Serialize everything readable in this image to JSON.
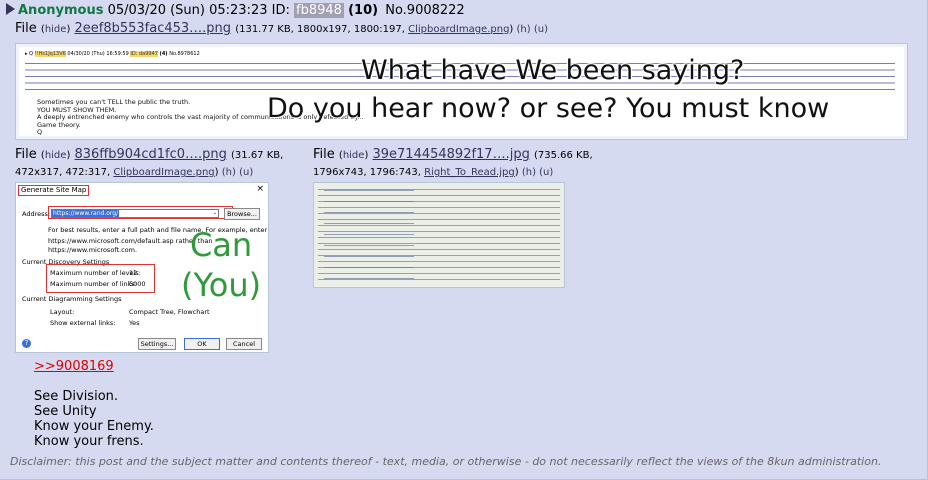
{
  "post": {
    "name": "Anonymous",
    "datetime": "05/03/20 (Sun) 05:23:23",
    "id_label": "ID:",
    "poster_id": "fb8948",
    "post_count": "(10)",
    "number": "No.9008222"
  },
  "files": [
    {
      "label": "File",
      "hide": "hide",
      "filename": "2eef8b553fac453….png",
      "meta": "(131.77 KB, 1800x197, 1800:197,",
      "original_name": "ClipboardImage.png",
      "h": "(h)",
      "u": "(u)",
      "close": ")"
    },
    {
      "label": "File",
      "hide": "hide",
      "filename": "836ffb904cd1fc0….png",
      "meta_a": "(31.67 KB,",
      "meta_b": "472x317, 472:317,",
      "original_name": "ClipboardImage.png",
      "h": "(h)",
      "u": "(u)",
      "close": ")"
    },
    {
      "label": "File",
      "hide": "hide",
      "filename": "39e714454892f17….jpg",
      "meta_a": "(735.66 KB,",
      "meta_b": "1796x743, 1796:743,",
      "original_name": "Right_To_Read.jpg",
      "h": "(h)",
      "u": "(u)",
      "close": ")"
    }
  ],
  "thumb1": {
    "header_q": "Q",
    "header_trip": "!!Hs1Jq13V6",
    "header_date": "04/30/20 (Thu) 16:59:59",
    "header_id": "ID: da9947",
    "header_count": "(4)",
    "header_no": "No.8978612",
    "post_text": "Sometimes you can't TELL the public the truth.\nYOU MUST SHOW THEM.\nA deeply entrenched enemy who controls the vast majority of communications is only defeated by...\nGame theory.\nQ",
    "overlay_line1": "What have We been saying?",
    "overlay_line2": "Do you hear now? or see? You must know"
  },
  "thumb2": {
    "title": "Generate Site Map",
    "close": "×",
    "address_label": "Address:",
    "address_value": "https://www.rand.org/",
    "browse": "Browse...",
    "hint1": "For best results, enter a full path and file name. For example, enter",
    "hint2": "https://www.microsoft.com/default.asp rather than",
    "hint3": "https://www.microsoft.com.",
    "section1": "Current Discovery Settings",
    "max_levels_label": "Maximum number of levels:",
    "max_levels_value": "12",
    "max_links_label": "Maximum number of links:",
    "max_links_value": "5000",
    "section2": "Current Diagramming Settings",
    "layout_label": "Layout:",
    "layout_value": "Compact Tree, Flowchart",
    "external_label": "Show external links:",
    "external_value": "Yes",
    "settings_btn": "Settings...",
    "ok_btn": "OK",
    "cancel_btn": "Cancel",
    "help": "?",
    "overlay": "Can\n(You)"
  },
  "quote_link": ">>9008169",
  "body_lines": [
    "See Division.",
    "See Unity",
    "Know your Enemy.",
    "Know your frens."
  ],
  "disclaimer": "Disclaimer: this post and the subject matter and contents thereof - text, media, or otherwise - do not necessarily reflect the views of the 8kun administration."
}
